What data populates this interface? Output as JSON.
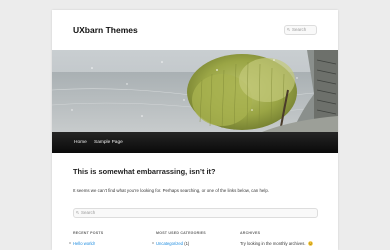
{
  "site": {
    "title": "UXbarn Themes"
  },
  "header": {
    "search_placeholder": "Search"
  },
  "nav": {
    "items": [
      {
        "label": "Home"
      },
      {
        "label": "Sample Page"
      }
    ]
  },
  "main": {
    "heading": "This is somewhat embarrassing, isn’t it?",
    "text": "It seems we can’t find what you’re looking for. Perhaps searching, or one of the links below, can help.",
    "search_placeholder": "Search"
  },
  "widgets": {
    "recent_posts": {
      "title": "RECENT POSTS",
      "item": "Hello world!"
    },
    "categories": {
      "title": "MOST USED CATEGORIES",
      "item": "Uncategorized",
      "count": "(1)"
    },
    "archives": {
      "title": "ARCHIVES",
      "text": "Try looking in the monthly archives."
    }
  },
  "colors": {
    "page_bg": "#ececec",
    "nav_bg": "#111111",
    "link": "#1b8be0",
    "smiley": "#f2c230"
  },
  "icons": {
    "header_search": "search-icon",
    "content_search": "search-icon",
    "archives_emoji": "smile-icon"
  }
}
